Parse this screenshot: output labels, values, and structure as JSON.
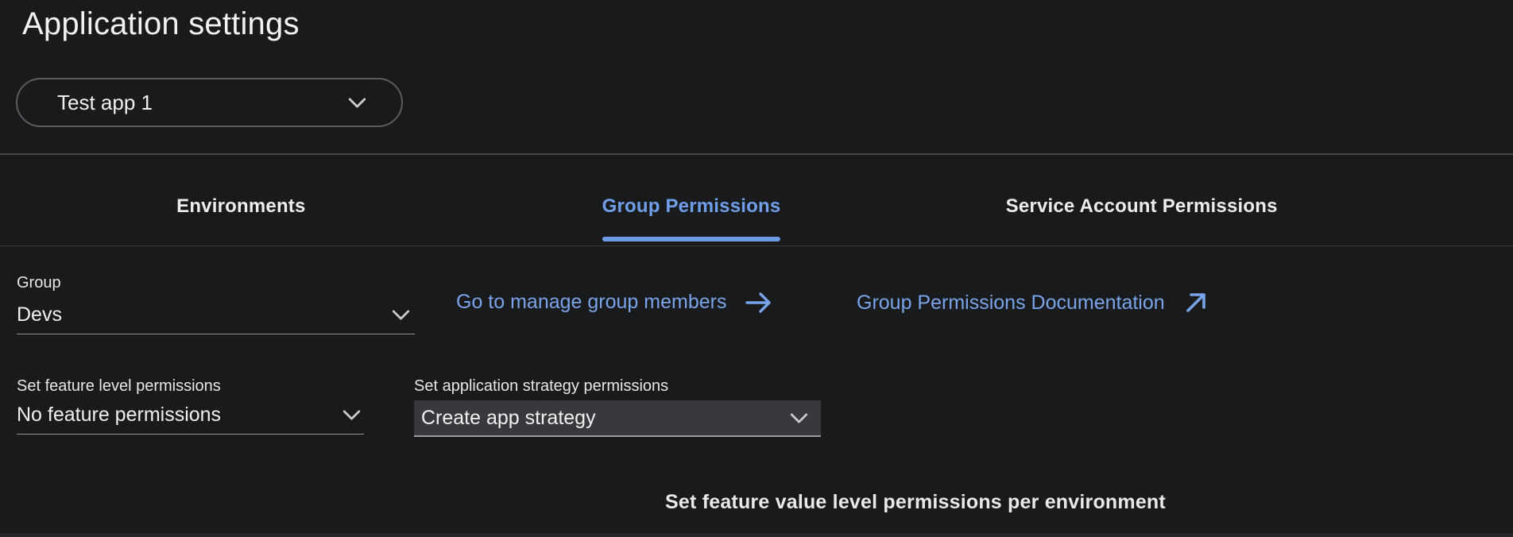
{
  "page": {
    "title": "Application settings"
  },
  "app_selector": {
    "value": "Test app 1",
    "icon": "chevron-down-icon"
  },
  "tabs": [
    {
      "label": "Environments",
      "active": false
    },
    {
      "label": "Group Permissions",
      "active": true
    },
    {
      "label": "Service Account Permissions",
      "active": false
    }
  ],
  "group_section": {
    "label": "Group",
    "value": "Devs",
    "icon": "chevron-down-icon",
    "links": [
      {
        "label": "Go to manage group members",
        "icon": "arrow-right-icon"
      },
      {
        "label": "Group Permissions Documentation",
        "icon": "arrow-outward-icon"
      }
    ]
  },
  "permissions": {
    "feature": {
      "label": "Set feature level permissions",
      "value": "No feature permissions",
      "icon": "chevron-down-icon"
    },
    "strategy": {
      "label": "Set application strategy permissions",
      "value": "Create app strategy",
      "icon": "chevron-down-icon"
    }
  },
  "footer": {
    "heading": "Set feature value level permissions per environment"
  },
  "colors": {
    "background": "#191A1C",
    "accent_blue": "#6F9FEA",
    "tab_underline_blue": "#6C9AE4",
    "link_blue": "#7AA4EA",
    "text_primary": "#F0F0F1",
    "divider_gray": "#46474A",
    "filled_select_bg": "#38393C"
  }
}
